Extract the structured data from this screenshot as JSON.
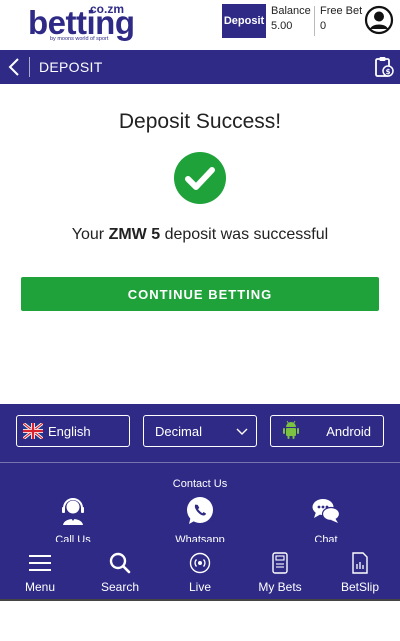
{
  "header": {
    "logo_main": "betting",
    "logo_tld": "co.zm",
    "logo_tagline": "by moons world of sport",
    "deposit_label": "Deposit",
    "balance_label": "Balance",
    "balance_value": "5.00",
    "freebet_label": "Free Bet",
    "freebet_value": "0"
  },
  "subbar": {
    "title": "DEPOSIT"
  },
  "main": {
    "title": "Deposit Success!",
    "msg_prefix": "Your ",
    "msg_amount": "ZMW 5",
    "msg_suffix": " deposit was successful",
    "continue_label": "CONTINUE BETTING"
  },
  "footer": {
    "language": "English",
    "odds_format": "Decimal",
    "app_label": "Android",
    "contact_title": "Contact Us",
    "contacts": [
      {
        "label": "Call Us",
        "icon": "support-agent-icon"
      },
      {
        "label": "Whatsapp",
        "icon": "whatsapp-icon"
      },
      {
        "label": "Chat",
        "icon": "chat-bubbles-icon"
      }
    ]
  },
  "nav": [
    {
      "label": "Menu",
      "icon": "hamburger-icon"
    },
    {
      "label": "Search",
      "icon": "search-icon"
    },
    {
      "label": "Live",
      "icon": "live-broadcast-icon"
    },
    {
      "label": "My Bets",
      "icon": "ticket-icon"
    },
    {
      "label": "BetSlip",
      "icon": "betslip-icon"
    }
  ],
  "colors": {
    "brand": "#2e2a86",
    "success": "#1fa23a",
    "white": "#ffffff"
  }
}
